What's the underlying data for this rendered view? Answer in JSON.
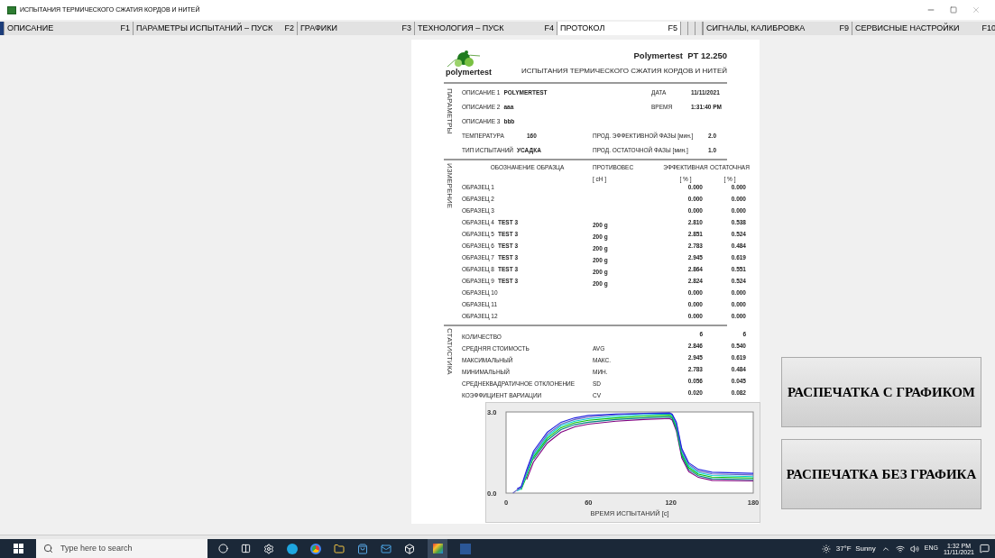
{
  "window": {
    "title": "ИСПЫТАНИЯ ТЕРМИЧЕСКОГО СЖАТИЯ КОРДОВ И НИТЕЙ"
  },
  "tabs": [
    {
      "label": "ОПИСАНИЕ",
      "key": "F1",
      "selected": false
    },
    {
      "label": "ПАРАМЕТРЫ ИСПЫТАНИЙ – ПУСК",
      "key": "F2",
      "selected": false
    },
    {
      "label": "ГРАФИКИ",
      "key": "F3",
      "selected": false
    },
    {
      "label": "ТЕХНОЛОГИЯ – ПУСК",
      "key": "F4",
      "selected": false
    },
    {
      "label": "ПРОТОКОЛ",
      "key": "F5",
      "selected": true
    },
    {
      "label": "СИГНАЛЫ, КАЛИБРОВКА",
      "key": "F9",
      "selected": false
    },
    {
      "label": "СЕРВИСНЫЕ НАСТРОЙКИ",
      "key": "F10",
      "selected": false
    }
  ],
  "report": {
    "brand": "polymertest",
    "model": "Polymertest  PT 12.250",
    "title": "ИСПЫТАНИЯ ТЕРМИЧЕСКОГО СЖАТИЯ КОРДОВ И НИТЕЙ",
    "parameters": {
      "side_label": "ПАРАМЕТРЫ",
      "descriptions": [
        {
          "label": "ОПИСАНИЕ 1",
          "value": "POLYMERTEST"
        },
        {
          "label": "ОПИСАНИЕ 2",
          "value": "aaa"
        },
        {
          "label": "ОПИСАНИЕ 3",
          "value": "bbb"
        }
      ],
      "date": {
        "label": "ДАТА",
        "value": "11/11/2021"
      },
      "time": {
        "label": "ВРЕМЯ",
        "value": "1:31:40 PM"
      },
      "temperature": {
        "label": "ТЕМПЕРАТУРА",
        "value": "160"
      },
      "test_type": {
        "label": "ТИП ИСПЫТАНИЙ",
        "value": "УСАДКА"
      },
      "effective_phase": {
        "label": "ПРОД. ЭФФЕКТИВНОЙ ФАЗЫ [мин.]",
        "value": "2.0"
      },
      "residual_phase": {
        "label": "ПРОД. ОСТАТОЧНОЙ ФАЗЫ [мин.]",
        "value": "1.0"
      }
    },
    "measurement": {
      "side_label": "ИЗМЕРЕНИЕ",
      "columns": [
        {
          "name": "ОБОЗНАЧЕНИЕ ОБРАЗЦА"
        },
        {
          "name": "ПРОТИВОВЕС",
          "unit": "[ cH ]"
        },
        {
          "name": "ЭФФЕКТИВНАЯ",
          "unit": "[ % ]"
        },
        {
          "name": "ОСТАТОЧНАЯ",
          "unit": "[ % ]"
        }
      ],
      "rows": [
        {
          "sample": "ОБРАЗЕЦ 1",
          "effective": "0.000",
          "residual": "0.000"
        },
        {
          "sample": "ОБРАЗЕЦ 2",
          "effective": "0.000",
          "residual": "0.000"
        },
        {
          "sample": "ОБРАЗЕЦ 3",
          "effective": "0.000",
          "residual": "0.000"
        },
        {
          "sample": "ОБРАЗЕЦ 4",
          "designation": "TEST 3",
          "counterweight": "200 g",
          "effective": "2.810",
          "residual": "0.538"
        },
        {
          "sample": "ОБРАЗЕЦ 5",
          "designation": "TEST 3",
          "counterweight": "200 g",
          "effective": "2.851",
          "residual": "0.524"
        },
        {
          "sample": "ОБРАЗЕЦ 6",
          "designation": "TEST 3",
          "counterweight": "200 g",
          "effective": "2.783",
          "residual": "0.484"
        },
        {
          "sample": "ОБРАЗЕЦ 7",
          "designation": "TEST 3",
          "counterweight": "200 g",
          "effective": "2.945",
          "residual": "0.619"
        },
        {
          "sample": "ОБРАЗЕЦ 8",
          "designation": "TEST 3",
          "counterweight": "200 g",
          "effective": "2.864",
          "residual": "0.551"
        },
        {
          "sample": "ОБРАЗЕЦ 9",
          "designation": "TEST 3",
          "counterweight": "200 g",
          "effective": "2.824",
          "residual": "0.524"
        },
        {
          "sample": "ОБРАЗЕЦ 10",
          "effective": "0.000",
          "residual": "0.000"
        },
        {
          "sample": "ОБРАЗЕЦ 11",
          "effective": "0.000",
          "residual": "0.000"
        },
        {
          "sample": "ОБРАЗЕЦ 12",
          "effective": "0.000",
          "residual": "0.000"
        }
      ]
    },
    "statistics": {
      "side_label": "СТАТИСТИКА",
      "rows": [
        {
          "label": "КОЛИЧЕСТВО",
          "effective": "6",
          "residual": "6"
        },
        {
          "label": "СРЕДНЯЯ СТОИМОСТЬ",
          "symbol": "AVG",
          "effective": "2.846",
          "residual": "0.540"
        },
        {
          "label": "МАКСИМАЛЬНЫЙ",
          "symbol": "МАКС.",
          "effective": "2.945",
          "residual": "0.619"
        },
        {
          "label": "МИНИМАЛЬНЫЙ",
          "symbol": "МИН.",
          "effective": "2.783",
          "residual": "0.484"
        },
        {
          "label": "СРЕДНЕКВАДРАТИЧНОЕ ОТКЛОНЕНИЕ",
          "symbol": "SD",
          "effective": "0.056",
          "residual": "0.045"
        },
        {
          "label": "КОЭФФИЦИЕНТ ВАРИАЦИИ",
          "symbol": "CV",
          "effective": "0.020",
          "residual": "0.082"
        }
      ]
    },
    "chart_data": {
      "type": "line",
      "xlabel": "ВРЕМЯ ИСПЫТАНИЙ [c]",
      "x": [
        5,
        8,
        11,
        15,
        20,
        30,
        40,
        50,
        60,
        80,
        100,
        119,
        121,
        124,
        128,
        133,
        140,
        150,
        180
      ],
      "xlim": [
        0,
        180
      ],
      "ylim": [
        0,
        3
      ],
      "xticks": [
        0,
        60,
        120,
        180
      ],
      "yticks": [
        {
          "value": 0,
          "label": "0.0"
        },
        {
          "value": 3,
          "label": "3.0"
        }
      ],
      "series": [
        {
          "color": "#800080",
          "values": [
            null,
            null,
            null,
            0.5,
            1.15,
            1.85,
            2.25,
            2.45,
            2.55,
            2.66,
            2.72,
            2.76,
            2.7,
            2.3,
            1.3,
            0.8,
            0.58,
            0.47,
            0.45
          ]
        },
        {
          "color": "#008080",
          "values": [
            null,
            null,
            null,
            null,
            1.25,
            1.95,
            2.35,
            2.53,
            2.62,
            2.72,
            2.78,
            2.82,
            2.76,
            2.37,
            1.38,
            0.87,
            0.64,
            0.53,
            0.5
          ]
        },
        {
          "color": "#00c000",
          "values": [
            null,
            null,
            0.12,
            0.62,
            1.33,
            2.03,
            2.42,
            2.6,
            2.69,
            2.78,
            2.84,
            2.88,
            2.82,
            2.44,
            1.45,
            0.94,
            0.7,
            0.59,
            0.56
          ]
        },
        {
          "color": "#00d0d0",
          "values": [
            null,
            0.08,
            0.16,
            0.7,
            1.4,
            2.1,
            2.49,
            2.66,
            2.75,
            2.84,
            2.9,
            2.93,
            2.87,
            2.5,
            1.52,
            1.0,
            0.76,
            0.65,
            0.61
          ]
        },
        {
          "color": "#6060c0",
          "values": [
            0,
            0.12,
            0.2,
            0.78,
            1.47,
            2.17,
            2.55,
            2.72,
            2.81,
            2.9,
            2.95,
            2.98,
            2.92,
            2.56,
            1.58,
            1.06,
            0.82,
            0.71,
            0.67
          ]
        },
        {
          "color": "#2020e0",
          "values": [
            null,
            0.16,
            0.24,
            0.86,
            1.55,
            2.25,
            2.62,
            2.78,
            2.87,
            2.92,
            2.94,
            2.95,
            2.91,
            2.63,
            1.65,
            1.12,
            0.88,
            0.77,
            0.73
          ]
        }
      ]
    }
  },
  "buttons": [
    {
      "label": "РАСПЕЧАТКА С ГРАФИКОМ"
    },
    {
      "label": "РАСПЕЧАТКА БЕЗ ГРАФИКА"
    }
  ],
  "taskbar": {
    "search": {
      "placeholder": "Type here to search"
    },
    "weather": "37°F  Sunny",
    "language": "ENG",
    "time": "1:32 PM",
    "date": "11/11/2021"
  }
}
